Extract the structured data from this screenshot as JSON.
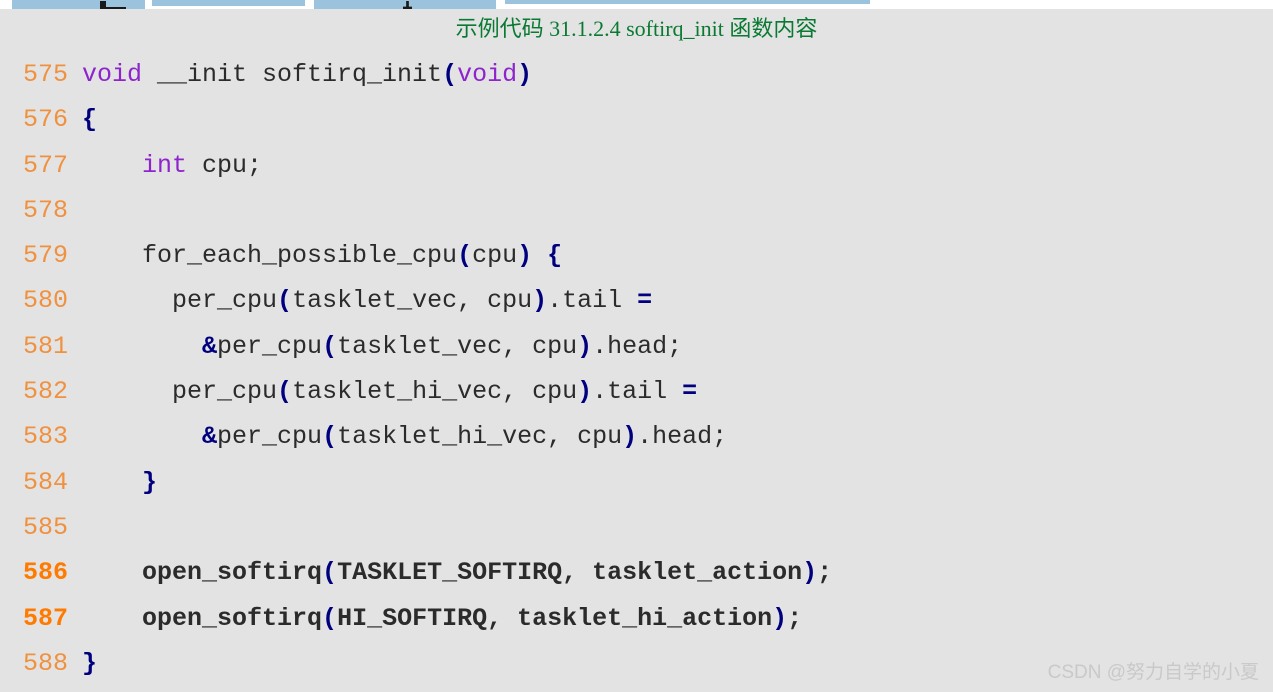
{
  "page": {
    "background_color": "#e3e3e3",
    "caption": "示例代码 31.1.2.4 softirq_init 函数内容",
    "caption_color": "#0a7a32"
  },
  "top_strip": {
    "bar_color": "#9cc3dd",
    "bars": [
      {
        "label": "partial-ui-bar-1"
      },
      {
        "label": "partial-ui-bar-2"
      },
      {
        "label": "partial-ui-bar-3"
      },
      {
        "label": "partial-ui-bar-4"
      }
    ]
  },
  "code": {
    "language": "c",
    "line_number_color": "#f0913f",
    "line_number_highlight_color": "#ff7a00",
    "keyword_color": "#8e24cc",
    "punctuation_color": "#00007f",
    "text_color": "#2b2b2b",
    "lines": [
      {
        "num": "575",
        "bold": false,
        "text": "void __init softirq_init(void)"
      },
      {
        "num": "576",
        "bold": false,
        "text": "{"
      },
      {
        "num": "577",
        "bold": false,
        "text": "    int cpu;"
      },
      {
        "num": "578",
        "bold": false,
        "text": ""
      },
      {
        "num": "579",
        "bold": false,
        "text": "    for_each_possible_cpu(cpu) {"
      },
      {
        "num": "580",
        "bold": false,
        "text": "      per_cpu(tasklet_vec, cpu).tail ="
      },
      {
        "num": "581",
        "bold": false,
        "text": "        &per_cpu(tasklet_vec, cpu).head;"
      },
      {
        "num": "582",
        "bold": false,
        "text": "      per_cpu(tasklet_hi_vec, cpu).tail ="
      },
      {
        "num": "583",
        "bold": false,
        "text": "        &per_cpu(tasklet_hi_vec, cpu).head;"
      },
      {
        "num": "584",
        "bold": false,
        "text": "    }"
      },
      {
        "num": "585",
        "bold": false,
        "text": ""
      },
      {
        "num": "586",
        "bold": true,
        "text": "    open_softirq(TASKLET_SOFTIRQ, tasklet_action);"
      },
      {
        "num": "587",
        "bold": true,
        "text": "    open_softirq(HI_SOFTIRQ, tasklet_hi_action);"
      },
      {
        "num": "588",
        "bold": false,
        "text": "}"
      }
    ]
  },
  "watermark": {
    "text": "CSDN @努力自学的小夏",
    "color": "#c9c9c9"
  }
}
